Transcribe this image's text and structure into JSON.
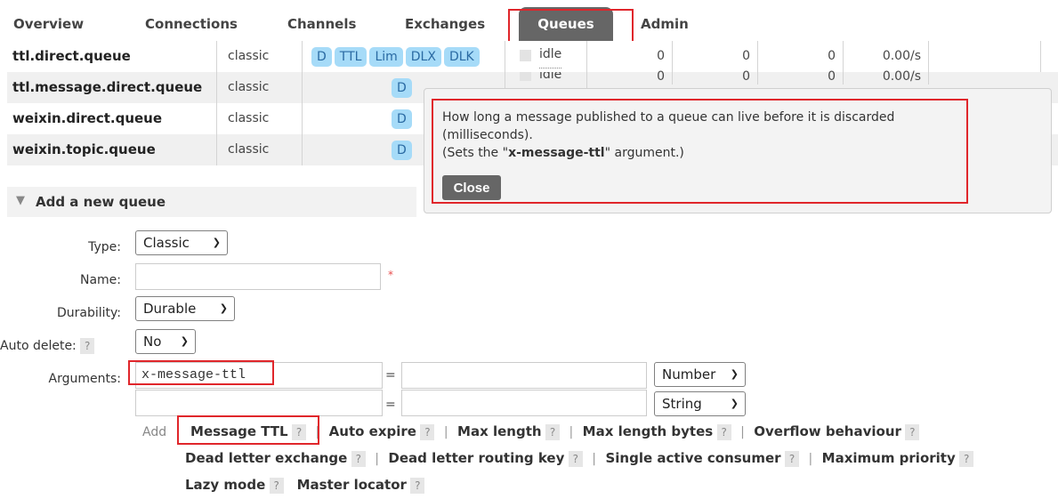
{
  "tabs": [
    {
      "label": "Overview"
    },
    {
      "label": "Connections"
    },
    {
      "label": "Channels"
    },
    {
      "label": "Exchanges"
    },
    {
      "label": "Queues",
      "active": true
    },
    {
      "label": "Admin"
    }
  ],
  "queues": [
    {
      "name": "ttl.direct.queue",
      "type": "classic",
      "features": [
        "D",
        "TTL",
        "Lim",
        "DLX",
        "DLK"
      ],
      "state": "idle",
      "ready": "0",
      "unacked": "0",
      "total": "0",
      "rate": "0.00/s"
    },
    {
      "name": "ttl.message.direct.queue",
      "type": "classic",
      "features": [
        "D"
      ],
      "state": "idle",
      "ready": "0",
      "unacked": "0",
      "total": "0",
      "rate": "0.00/s"
    },
    {
      "name": "weixin.direct.queue",
      "type": "classic",
      "features": [
        "D"
      ]
    },
    {
      "name": "weixin.topic.queue",
      "type": "classic",
      "features": [
        "D"
      ]
    }
  ],
  "tooltip": {
    "line1": "How long a message published to a queue can live before it is discarded",
    "line2": "(milliseconds).",
    "line3_prefix": "(Sets the \"",
    "line3_arg": "x-message-ttl",
    "line3_suffix": "\" argument.)",
    "close_label": "Close"
  },
  "add_queue": {
    "section_title": "Add a new queue",
    "type_label": "Type:",
    "type_value": "Classic",
    "name_label": "Name:",
    "name_value": "",
    "required_mark": "*",
    "durability_label": "Durability:",
    "durability_value": "Durable",
    "auto_delete_label": "Auto delete:",
    "auto_delete_value": "No",
    "arguments_label": "Arguments:",
    "arg1_key": "x-message-ttl",
    "arg1_value": "",
    "arg1_type": "Number",
    "arg2_key": "",
    "arg2_value": "",
    "arg2_type": "String",
    "equals": "=",
    "help": "?",
    "add_label": "Add",
    "options_line1": [
      "Message TTL",
      "Auto expire",
      "Max length",
      "Max length bytes",
      "Overflow behaviour"
    ],
    "options_line2": [
      "Dead letter exchange",
      "Dead letter routing key",
      "Single active consumer",
      "Maximum priority"
    ],
    "options_line3": [
      "Lazy mode",
      "Master locator"
    ],
    "separator": "|"
  },
  "colors": {
    "highlight": "#e0262b",
    "active_tab": "#666666",
    "badge_bg": "#a6dbf8",
    "badge_text": "#2a6aa3"
  }
}
